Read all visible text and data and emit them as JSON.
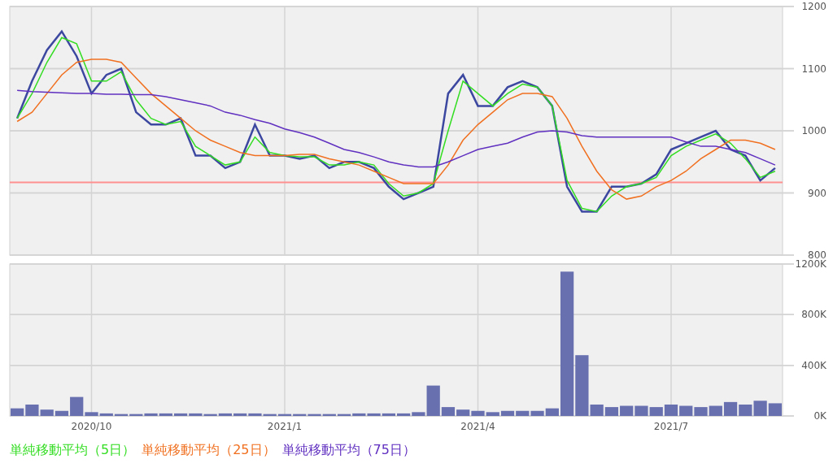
{
  "price_chart": {
    "chart_data": {
      "type": "line",
      "grid": true,
      "categories": [
        null,
        null,
        null,
        null,
        null,
        null,
        null,
        null,
        null,
        null,
        null,
        null,
        null,
        null,
        null,
        null,
        null,
        null,
        null,
        null,
        null,
        null,
        null,
        null,
        null,
        null,
        null,
        null,
        null,
        null,
        null,
        null,
        null,
        null,
        null,
        null,
        null,
        null,
        null,
        null,
        null,
        null,
        null,
        null,
        null,
        null,
        null,
        null,
        null,
        null,
        null,
        null
      ],
      "ylim": [
        800,
        1200
      ],
      "yticks": [
        800,
        900,
        1000,
        1100,
        1200
      ],
      "series": [
        {
          "color": "#3c48a0",
          "values": [
            1020,
            1080,
            1130,
            1160,
            1120,
            1060,
            1090,
            1100,
            1030,
            1010,
            1010,
            1020,
            960,
            960,
            940,
            950,
            1010,
            960,
            960,
            955,
            960,
            940,
            950,
            950,
            940,
            910,
            890,
            900,
            910,
            1060,
            1090,
            1040,
            1040,
            1070,
            1080,
            1070,
            1040,
            910,
            870,
            870,
            910,
            910,
            915,
            930,
            970,
            980,
            990,
            1000,
            970,
            960,
            920,
            940
          ]
        },
        {
          "name": "単純移動平均（5日）",
          "color": "#33dd22",
          "values": [
            1020,
            1060,
            1110,
            1150,
            1140,
            1080,
            1080,
            1095,
            1050,
            1020,
            1010,
            1015,
            975,
            960,
            945,
            950,
            990,
            965,
            960,
            958,
            958,
            945,
            945,
            950,
            945,
            915,
            895,
            900,
            915,
            1000,
            1080,
            1060,
            1040,
            1060,
            1075,
            1070,
            1040,
            920,
            875,
            870,
            895,
            910,
            915,
            925,
            960,
            975,
            985,
            995,
            980,
            955,
            925,
            935
          ]
        },
        {
          "name": "単純移動平均（25日）",
          "color": "#f07020",
          "values": [
            1015,
            1030,
            1060,
            1090,
            1110,
            1115,
            1115,
            1110,
            1085,
            1060,
            1040,
            1020,
            1000,
            985,
            975,
            965,
            960,
            960,
            960,
            962,
            962,
            955,
            950,
            945,
            935,
            925,
            915,
            915,
            915,
            945,
            985,
            1010,
            1030,
            1050,
            1060,
            1060,
            1055,
            1020,
            975,
            935,
            905,
            890,
            895,
            910,
            920,
            935,
            955,
            970,
            985,
            985,
            980,
            970
          ]
        },
        {
          "name": "単純移動平均（75日）",
          "color": "#6030c0",
          "values": [
            1065,
            1063,
            1062,
            1061,
            1060,
            1060,
            1059,
            1059,
            1058,
            1058,
            1055,
            1050,
            1045,
            1040,
            1030,
            1025,
            1018,
            1012,
            1003,
            997,
            990,
            980,
            970,
            965,
            958,
            950,
            945,
            942,
            942,
            950,
            960,
            970,
            975,
            980,
            990,
            998,
            1000,
            998,
            992,
            990,
            990,
            990,
            990,
            990,
            990,
            982,
            975,
            975,
            970,
            965,
            955,
            945
          ]
        }
      ],
      "ref_lines": [
        {
          "axis": "y",
          "value": 917,
          "color": "#ff9090"
        }
      ]
    }
  },
  "volume_chart": {
    "chart_data": {
      "type": "bar",
      "grid": true,
      "categories": [
        null,
        null,
        null,
        null,
        null,
        "2020/10",
        null,
        null,
        null,
        null,
        null,
        null,
        null,
        null,
        null,
        null,
        null,
        null,
        "2021/1",
        null,
        null,
        null,
        null,
        null,
        null,
        null,
        null,
        null,
        null,
        null,
        null,
        "2021/4",
        null,
        null,
        null,
        null,
        null,
        null,
        null,
        null,
        null,
        null,
        null,
        null,
        "2021/7",
        null,
        null,
        null,
        null,
        null,
        null,
        null
      ],
      "ylim": [
        0,
        1200
      ],
      "yticks": [
        {
          "value": 0,
          "label": "0K"
        },
        {
          "value": 400,
          "label": "400K"
        },
        {
          "value": 800,
          "label": "800K"
        },
        {
          "value": 1200,
          "label": "1200K"
        }
      ],
      "series": [
        {
          "color": "#6870b0",
          "values": [
            60,
            90,
            50,
            40,
            150,
            30,
            20,
            15,
            15,
            20,
            20,
            20,
            20,
            15,
            20,
            20,
            20,
            15,
            15,
            15,
            15,
            15,
            15,
            20,
            20,
            20,
            20,
            30,
            240,
            70,
            50,
            40,
            30,
            40,
            40,
            40,
            60,
            1140,
            480,
            90,
            70,
            80,
            80,
            70,
            90,
            80,
            70,
            80,
            110,
            90,
            120,
            100
          ]
        }
      ]
    }
  }
}
